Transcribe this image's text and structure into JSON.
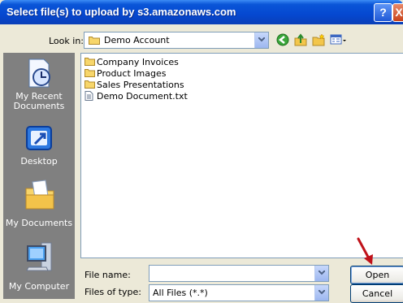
{
  "window": {
    "title": "Select file(s) to upload by s3.amazonaws.com",
    "help_label": "?",
    "close_label": "X"
  },
  "lookin": {
    "label": "Look in:",
    "value": "Demo Account"
  },
  "places": [
    {
      "label": "My Recent Documents"
    },
    {
      "label": "Desktop"
    },
    {
      "label": "My Documents"
    },
    {
      "label": "My Computer"
    }
  ],
  "files": [
    {
      "name": "Company Invoices",
      "type": "folder"
    },
    {
      "name": "Product Images",
      "type": "folder"
    },
    {
      "name": "Sales Presentations",
      "type": "folder"
    },
    {
      "name": "Demo Document.txt",
      "type": "text-file"
    }
  ],
  "filename": {
    "label": "File name:",
    "value": ""
  },
  "filetype": {
    "label": "Files of type:",
    "value": "All Files (*.*)"
  },
  "buttons": {
    "open": "Open",
    "cancel": "Cancel"
  },
  "colors": {
    "titlebar": "#0548D0",
    "dialog_bg": "#ECE9D8",
    "places_bg": "#808080",
    "annotation_arrow": "#C0121A"
  }
}
